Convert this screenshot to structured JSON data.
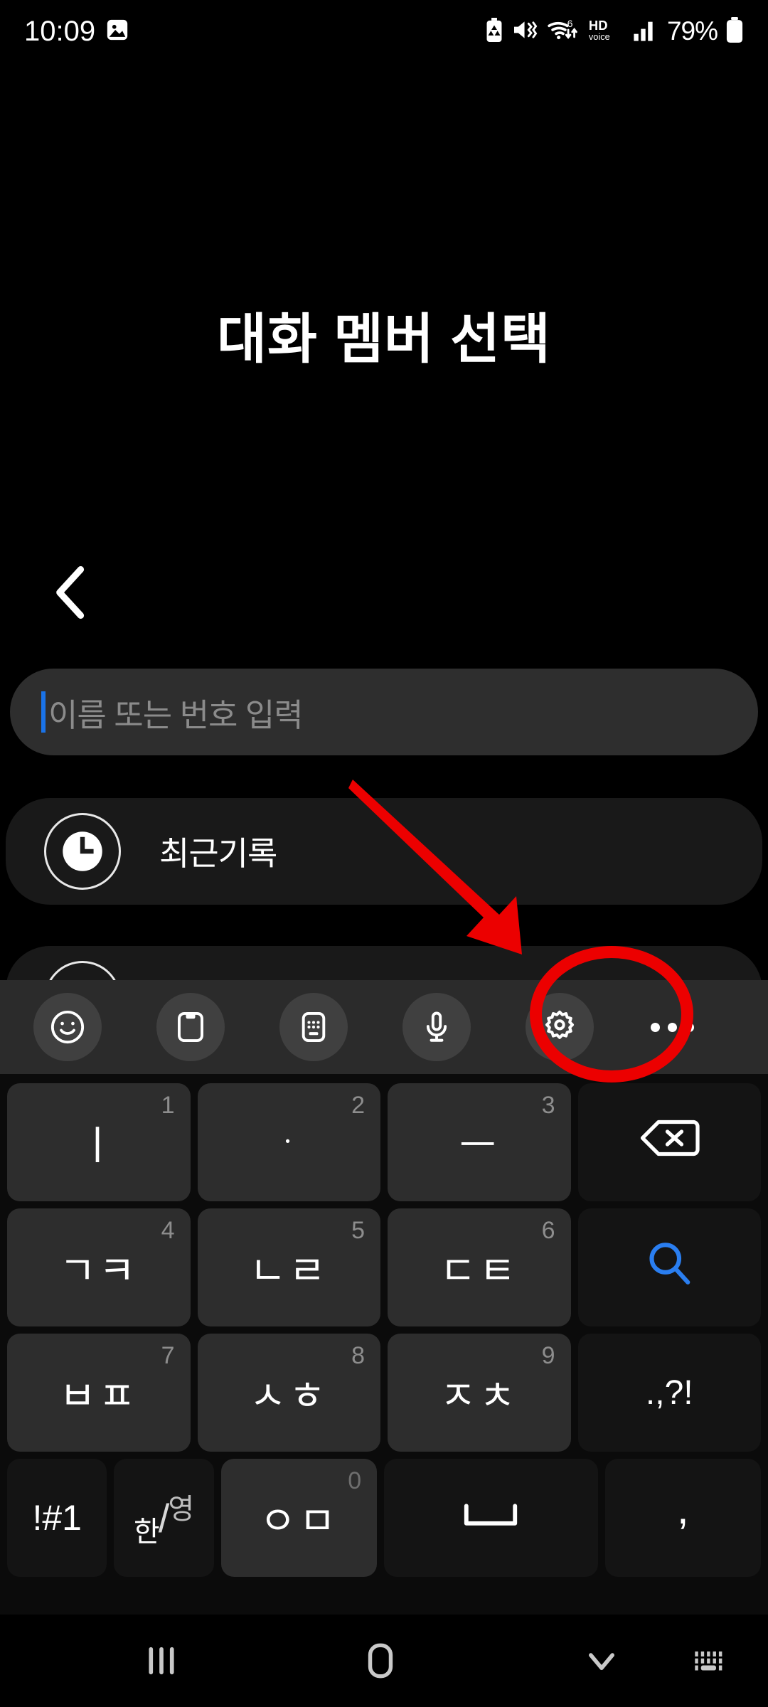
{
  "status_bar": {
    "time": "10:09",
    "battery_percent": "79%",
    "left_icons": [
      "gallery-image-icon"
    ],
    "right_icons": [
      "battery-saver-icon",
      "mute-vibrate-icon",
      "wifi-6-data-icon",
      "hd-voice-icon",
      "signal-bars-icon",
      "battery-icon"
    ],
    "hd_voice_top": "HD",
    "hd_voice_bottom": "voice",
    "wifi_generation": "6"
  },
  "header": {
    "title": "대화 멤버 선택",
    "back_icon": "back-chevron-icon"
  },
  "search": {
    "placeholder": "이름 또는 번호 입력",
    "value": "",
    "caret_color": "#1a73e8"
  },
  "list": {
    "items": [
      {
        "label": "최근기록",
        "icon": "clock-icon"
      },
      {
        "label": "",
        "icon": "contact-icon"
      }
    ]
  },
  "keyboard_toolbar": {
    "buttons": [
      {
        "name": "emoji-icon",
        "label": "emoji"
      },
      {
        "name": "clipboard-icon",
        "label": "clipboard"
      },
      {
        "name": "keypad-icon",
        "label": "keypad"
      },
      {
        "name": "microphone-icon",
        "label": "voice input"
      },
      {
        "name": "gear-icon",
        "label": "settings"
      }
    ],
    "more_icon": "more-options-icon"
  },
  "keyboard": {
    "layout_name": "천지인",
    "rows": [
      [
        {
          "label": "ㅣ",
          "num": "1",
          "type": "letter"
        },
        {
          "label": "ㆍ",
          "num": "2",
          "type": "letter"
        },
        {
          "label": "ㅡ",
          "num": "3",
          "type": "letter"
        },
        {
          "label": "backspace-icon",
          "num": "",
          "type": "fn"
        }
      ],
      [
        {
          "label": "ㄱㅋ",
          "num": "4",
          "type": "letter"
        },
        {
          "label": "ㄴㄹ",
          "num": "5",
          "type": "letter"
        },
        {
          "label": "ㄷㅌ",
          "num": "6",
          "type": "letter"
        },
        {
          "label": "search-icon",
          "num": "",
          "type": "fn"
        }
      ],
      [
        {
          "label": "ㅂㅍ",
          "num": "7",
          "type": "letter"
        },
        {
          "label": "ㅅㅎ",
          "num": "8",
          "type": "letter"
        },
        {
          "label": "ㅈㅊ",
          "num": "9",
          "type": "letter"
        },
        {
          "label": ".,?!",
          "num": "",
          "type": "fn"
        }
      ],
      [
        {
          "label": "!#1",
          "num": "",
          "type": "fn"
        },
        {
          "label": "한/영",
          "num": "",
          "type": "fn"
        },
        {
          "label": "ㅇㅁ",
          "num": "0",
          "type": "letter"
        },
        {
          "label": "space-icon",
          "num": "",
          "type": "fn"
        },
        {
          "label": ",",
          "num": "",
          "type": "fn"
        }
      ]
    ],
    "lang_key": {
      "korean": "한",
      "slash": "/",
      "english": "영"
    },
    "search_key_color": "#2a7ef0"
  },
  "nav_bar": {
    "recents_icon": "recent-apps-icon",
    "home_icon": "home-icon",
    "hide_keyboard_icon": "hide-keyboard-chevron-icon",
    "keyboard_switch_icon": "keyboard-switch-icon"
  },
  "annotations": {
    "highlight_color": "#ec0000",
    "circle_target": "gear-icon",
    "arrow_target": "gear-icon"
  }
}
